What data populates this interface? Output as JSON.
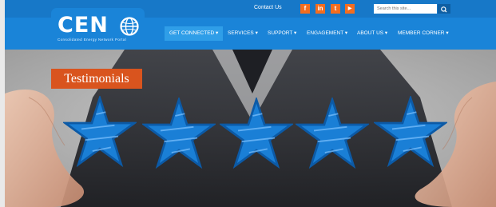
{
  "header": {
    "logo": "CEN",
    "tagline": "Consolidated Energy Network Portal",
    "contact_label": "Contact Us",
    "social": [
      {
        "name": "facebook-icon",
        "glyph": "f"
      },
      {
        "name": "linkedin-icon",
        "glyph": "in"
      },
      {
        "name": "twitter-icon",
        "glyph": "t"
      },
      {
        "name": "youtube-icon",
        "glyph": "▶"
      }
    ],
    "search_placeholder": "Search this site..."
  },
  "nav": {
    "items": [
      {
        "label": "GET CONNECTED",
        "active": true
      },
      {
        "label": "SERVICES",
        "active": false
      },
      {
        "label": "SUPPORT",
        "active": false
      },
      {
        "label": "ENGAGEMENT",
        "active": false
      },
      {
        "label": "ABOUT US",
        "active": false
      },
      {
        "label": "MEMBER CORNER",
        "active": false
      }
    ]
  },
  "hero": {
    "badge": "Testimonials"
  },
  "colors": {
    "topbar": "#1778c8",
    "navbar": "#1a84d8",
    "accent": "#d9541e",
    "social": "#f36d1f",
    "star": "#1a7fd6"
  }
}
